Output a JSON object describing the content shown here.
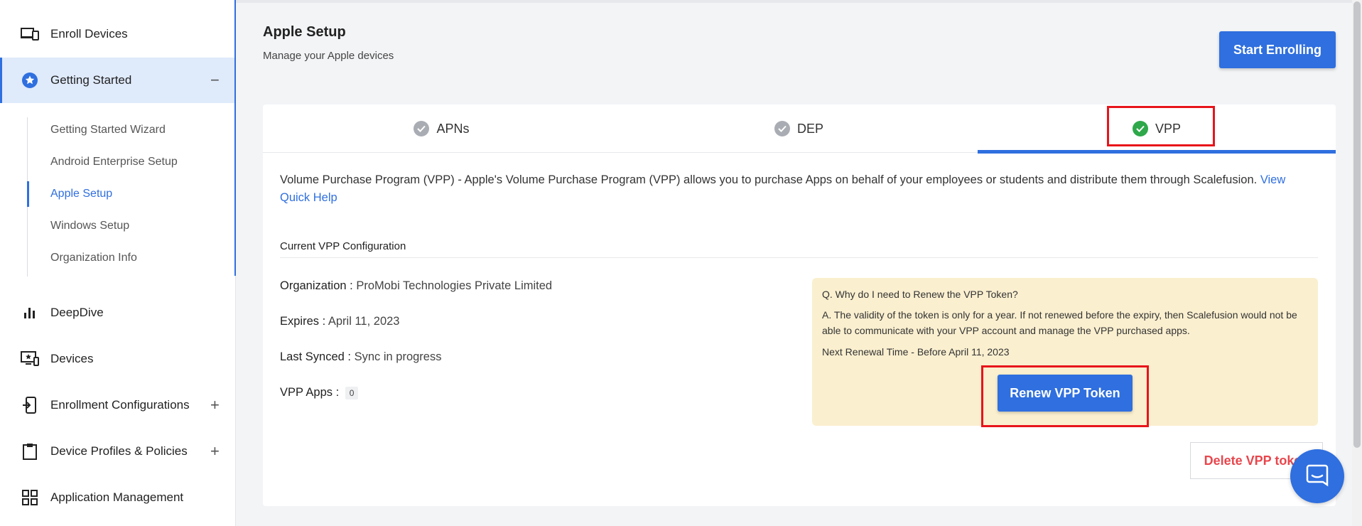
{
  "sidebar": {
    "items": [
      {
        "label": "Enroll Devices",
        "icon": "devices-icon"
      },
      {
        "label": "Getting Started",
        "icon": "star-badge-icon",
        "toggle": "−"
      },
      {
        "label": "DeepDive",
        "icon": "bar-chart-icon"
      },
      {
        "label": "Devices",
        "icon": "monitor-icon"
      },
      {
        "label": "Enrollment Configurations",
        "icon": "phone-enroll-icon",
        "toggle": "+"
      },
      {
        "label": "Device Profiles & Policies",
        "icon": "clipboard-icon",
        "toggle": "+"
      },
      {
        "label": "Application Management",
        "icon": "grid-icon"
      }
    ],
    "getting_started_sub": [
      "Getting Started Wizard",
      "Android Enterprise Setup",
      "Apple Setup",
      "Windows Setup",
      "Organization Info"
    ]
  },
  "header": {
    "title": "Apple Setup",
    "subtitle": "Manage your Apple devices",
    "start_enrolling": "Start Enrolling"
  },
  "tabs": [
    {
      "label": "APNs"
    },
    {
      "label": "DEP"
    },
    {
      "label": "VPP"
    }
  ],
  "vpp": {
    "description": "Volume Purchase Program (VPP) - Apple's Volume Purchase Program (VPP) allows you to purchase Apps on behalf of your employees or students and distribute them through Scalefusion.",
    "help_link": "View Quick Help",
    "section_title": "Current VPP Configuration",
    "organization_label": "Organization :",
    "organization_value": "ProMobi Technologies Private Limited",
    "expires_label": "Expires :",
    "expires_value": "April 11, 2023",
    "last_synced_label": "Last Synced :",
    "last_synced_value": "Sync in progress",
    "apps_label": "VPP Apps :",
    "apps_count": "0",
    "info_question": "Q. Why do I need to Renew the VPP Token?",
    "info_answer": "A. The validity of the token is only for a year. If not renewed before the expiry, then Scalefusion would not be able to communicate with your VPP account and manage the VPP purchased apps.",
    "info_next": "Next Renewal Time - Before April 11, 2023",
    "renew_button": "Renew VPP Token",
    "delete_button": "Delete VPP token"
  },
  "colors": {
    "accent": "#2f6fdf",
    "success": "#2ea84a",
    "danger": "#e8464c",
    "highlight": "#e8141b",
    "info_bg": "#faefcf"
  }
}
